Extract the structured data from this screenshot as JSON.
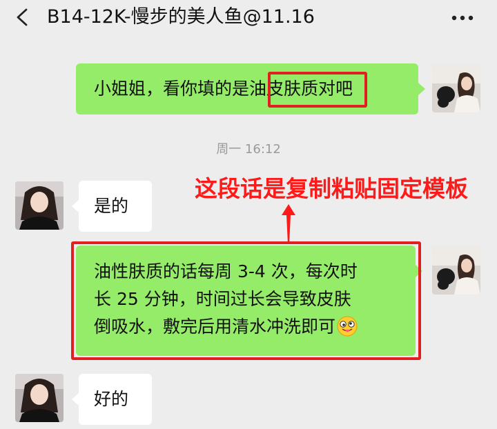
{
  "header": {
    "title": "B14-12K-慢步的美人鱼@11.16",
    "back_icon": "chevron-left-icon",
    "more_icon": "ellipsis-icon"
  },
  "messages": [
    {
      "sender": "self",
      "text_before": "小姐姐，看你填的是",
      "text_highlight": "油皮肤质",
      "text_after": "对吧"
    },
    {
      "type": "timestamp",
      "text": "周一 16:12"
    },
    {
      "sender": "other",
      "text": "是的"
    },
    {
      "sender": "self",
      "lines": [
        "油性肤质的话每周 3-4 次，每次时",
        "长 25 分钟，时间过长会导致皮肤",
        "倒吸水，敷完后用清水冲洗即可"
      ],
      "emoji": "face-tongue-emoji"
    },
    {
      "sender": "other",
      "text": "好的"
    }
  ],
  "annotation": {
    "text": "这段话是复制粘贴固定模板"
  },
  "colors": {
    "background": "#ededed",
    "self_bubble": "#95ec69",
    "other_bubble": "#ffffff",
    "highlight": "#e02020",
    "annotation": "#ff1a1a",
    "timestamp": "#999999"
  }
}
